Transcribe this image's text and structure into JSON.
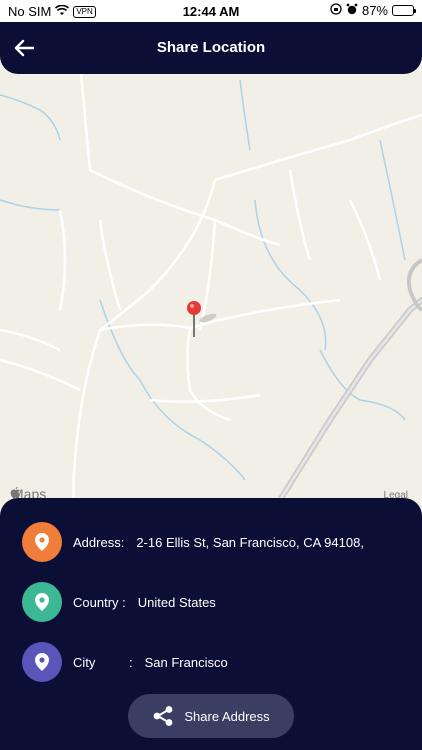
{
  "status_bar": {
    "carrier": "No SIM",
    "vpn": "VPN",
    "time": "12:44 AM",
    "battery": "87%",
    "battery_level": 0.87
  },
  "header": {
    "title": "Share Location"
  },
  "map": {
    "brand": "Maps",
    "legal": "Legal"
  },
  "details": {
    "address_label": "Address:",
    "address_value": "2-16 Ellis St, San Francisco, CA 94108,",
    "country_label": "Country :",
    "country_value": "United States",
    "city_label": "City",
    "city_sep": ":",
    "city_value": "San Francisco"
  },
  "actions": {
    "share_label": "Share Address"
  },
  "colors": {
    "primary": "#0c0f35",
    "address_icon": "#f07d3a",
    "country_icon": "#3cb894",
    "city_icon": "#5a55b8",
    "pin": "#e53935",
    "share_button": "#3b3e63"
  }
}
